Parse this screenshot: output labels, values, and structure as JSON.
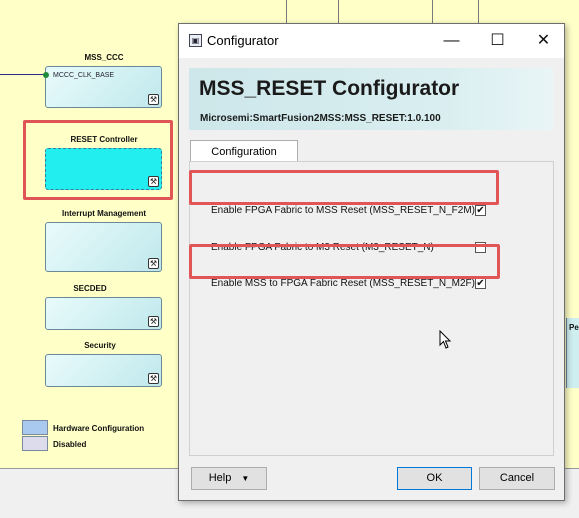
{
  "canvas": {
    "blocks": [
      {
        "title": "MSS_CCC",
        "port": "MCCC_CLK_BASE"
      },
      {
        "title": "RESET Controller"
      },
      {
        "title": "Interrupt Management"
      },
      {
        "title": "SECDED"
      },
      {
        "title": "Security"
      }
    ],
    "legend": [
      {
        "label": "Hardware Configuration",
        "color": "#a9c9ee"
      },
      {
        "label": "Disabled",
        "color": "#dcdcec"
      }
    ],
    "right_label": "Pe"
  },
  "dialog": {
    "window_title": "Configurator",
    "header_title": "MSS_RESET Configurator",
    "header_subtitle": "Microsemi:SmartFusion2MSS:MSS_RESET:1.0.100",
    "tab_label": "Configuration",
    "options": [
      {
        "label": "Enable FPGA Fabric to MSS Reset (MSS_RESET_N_F2M)",
        "checked": true
      },
      {
        "label": "Enable FPGA Fabric to M3 Reset  (M3_RESET_N)",
        "checked": false
      },
      {
        "label": "Enable MSS to FPGA Fabric Reset (MSS_RESET_N_M2F)",
        "checked": true
      }
    ],
    "buttons": {
      "help": "Help",
      "ok": "OK",
      "cancel": "Cancel"
    }
  },
  "colors": {
    "highlight": "#e05555",
    "canvas_bg": "#ffffc8",
    "reset_block": "#22eef0"
  }
}
